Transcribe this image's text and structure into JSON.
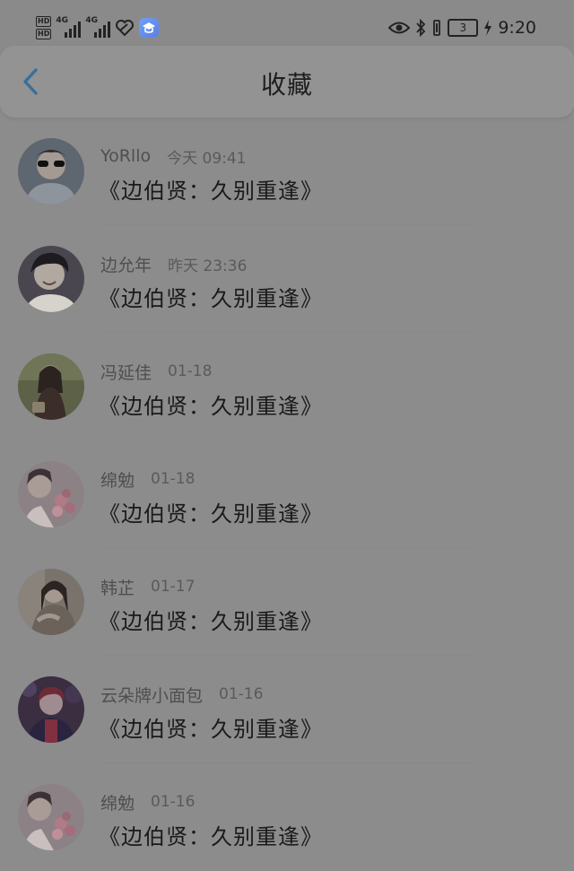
{
  "status_bar": {
    "hd_top": "HD",
    "hd_bottom": "HD",
    "network_1": "4G",
    "network_2": "4G",
    "battery_level": "3",
    "time": "9:20",
    "icons": [
      "eye-icon",
      "bluetooth-icon",
      "vibrate-icon",
      "battery-icon",
      "charging-icon",
      "heart-link-icon",
      "education-app-icon"
    ]
  },
  "header": {
    "title": "收藏",
    "back_icon": "chevron-left-icon",
    "accent_color": "#3a6f9a"
  },
  "favorites": [
    {
      "name": "YoRllo",
      "time": "今天 09:41",
      "title": "《边伯贤：久别重逢》",
      "avatar_color": "#5e6670"
    },
    {
      "name": "边允年",
      "time": "昨天 23:36",
      "title": "《边伯贤：久别重逢》",
      "avatar_color": "#4a4650"
    },
    {
      "name": "冯延佳",
      "time": "01-18",
      "title": "《边伯贤：久别重逢》",
      "avatar_color": "#5d6147"
    },
    {
      "name": "绵勉",
      "time": "01-18",
      "title": "《边伯贤：久别重逢》",
      "avatar_color": "#8c8285"
    },
    {
      "name": "韩芷",
      "time": "01-17",
      "title": "《边伯贤：久别重逢》",
      "avatar_color": "#7a736c"
    },
    {
      "name": "云朵牌小面包",
      "time": "01-16",
      "title": "《边伯贤：久别重逢》",
      "avatar_color": "#3a2e40"
    },
    {
      "name": "绵勉",
      "time": "01-16",
      "title": "《边伯贤：久别重逢》",
      "avatar_color": "#8c8285"
    }
  ]
}
